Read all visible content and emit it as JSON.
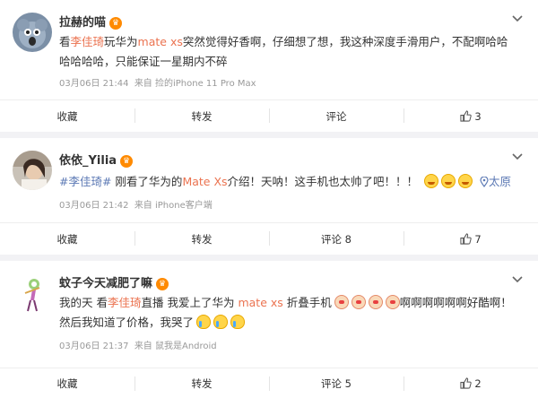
{
  "posts": [
    {
      "user": "拉赫的喵",
      "content_parts": [
        "看",
        "李佳琦",
        "玩华为",
        "mate xs",
        "突然觉得好香啊，仔细想了想，我这种深度手滑用户，不配啊哈哈哈哈哈哈，只能保证一星期内不碎"
      ],
      "time": "03月06日 21:44",
      "source": "来自 捡的iPhone 11 Pro Max",
      "actions": {
        "favorite": "收藏",
        "repost": "转发",
        "comment": "评论",
        "likes": "3"
      }
    },
    {
      "user": "依依_Yilia",
      "content_parts": [
        "#李佳琦#",
        " 刚看了华为的",
        "Mate Xs",
        "介绍！天呐！这手机也太帅了吧！！！"
      ],
      "location": "太原",
      "time": "03月06日 21:42",
      "source": "来自 iPhone客户端",
      "actions": {
        "favorite": "收藏",
        "repost": "转发",
        "comment": "评论 8",
        "likes": "7"
      }
    },
    {
      "user": "蚊子今天减肥了嘛",
      "content_parts": [
        "我的天 看",
        "李佳琦",
        "直播 我爱上了华为 ",
        "mate xs",
        " 折叠手机",
        "啊啊啊啊啊啊好酷啊！然后我知道了价格，我哭了"
      ],
      "time": "03月06日 21:37",
      "source": "来自 鼠我是Android",
      "actions": {
        "favorite": "收藏",
        "repost": "转发",
        "comment": "评论 5",
        "likes": "2"
      }
    }
  ],
  "icons": {
    "vip": "vip-crown-icon",
    "more": "chevron-down-icon",
    "like": "thumbs-up-icon",
    "location": "location-pin-icon"
  },
  "colors": {
    "link": "#eb7350",
    "topic": "#5d7ab5",
    "meta": "#999999",
    "vip": "#ff8a00"
  }
}
